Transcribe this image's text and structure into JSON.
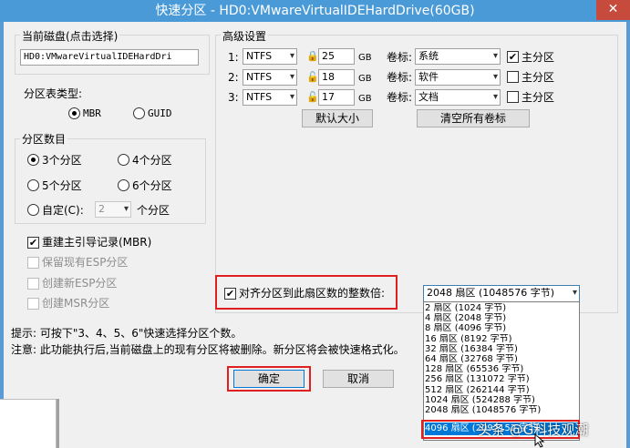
{
  "window": {
    "title": "快速分区 - HD0:VMwareVirtualIDEHardDrive(60GB)",
    "close_glyph": "✕"
  },
  "current_disk": {
    "label": "当前磁盘(点击选择)",
    "value": "HD0:VMwareVirtualIDEHardDri"
  },
  "partition_table": {
    "label": "分区表类型:",
    "options": [
      "MBR",
      "GUID"
    ],
    "selected": "MBR"
  },
  "partition_count": {
    "label": "分区数目",
    "options": [
      "3个分区",
      "4个分区",
      "5个分区",
      "6个分区"
    ],
    "selected": "3个分区",
    "custom_label": "自定(C):",
    "custom_value": "2",
    "custom_unit": "个分区"
  },
  "options": {
    "rebuild_mbr": "重建主引导记录(MBR)",
    "keep_esp": "保留现有ESP分区",
    "create_esp": "创建新ESP分区",
    "create_msr": "创建MSR分区"
  },
  "advanced": {
    "label": "高级设置",
    "unit": "GB",
    "volume_label": "卷标:",
    "primary_label": "主分区",
    "rows": [
      {
        "index": "1:",
        "fs": "NTFS",
        "size": "25",
        "name": "系统",
        "primary": true
      },
      {
        "index": "2:",
        "fs": "NTFS",
        "size": "18",
        "name": "软件",
        "primary": false
      },
      {
        "index": "3:",
        "fs": "NTFS",
        "size": "17",
        "name": "文档",
        "primary": false
      }
    ],
    "default_size_button": "默认大小",
    "clear_labels_button": "清空所有卷标"
  },
  "align": {
    "label": "对齐分区到此扇区数的整数倍:",
    "selected": "2048 扇区 (1048576 字节)",
    "list": [
      "2 扇区 (1024 字节)",
      "4 扇区 (2048 字节)",
      "8 扇区 (4096 字节)",
      "16 扇区 (8192 字节)",
      "32 扇区 (16384 字节)",
      "64 扇区 (32768 字节)",
      "128 扇区 (65536 字节)",
      "256 扇区 (131072 字节)",
      "512 扇区 (262144 字节)",
      "1024 扇区 (524288 字节)",
      "2048 扇区 (1048576 字节)",
      "4096 扇区 (2097152 字节)"
    ],
    "highlighted_index": 11
  },
  "hints": {
    "tip": "提示: 可按下\"3、4、5、6\"快速选择分区个数。",
    "warning": "注意: 此功能执行后,当前磁盘上的现有分区将被删除。新分区将会被快速格式化。"
  },
  "buttons": {
    "ok": "确定",
    "cancel": "取消"
  },
  "watermark": "头条 @G科技观潮"
}
